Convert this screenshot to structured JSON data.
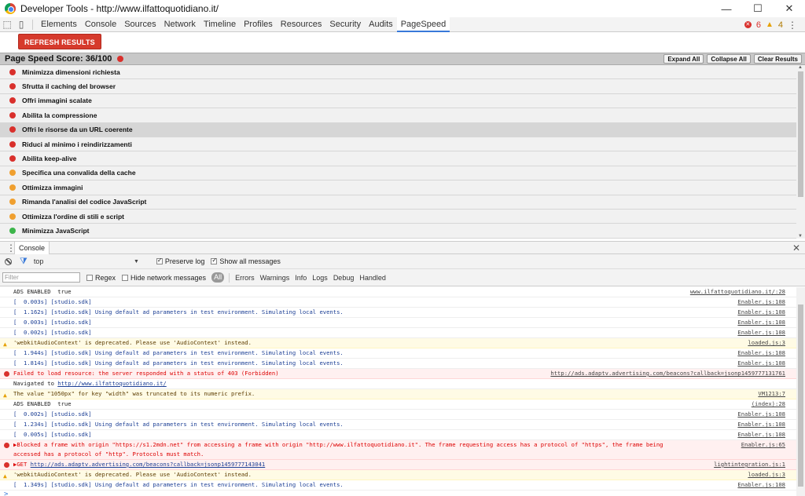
{
  "window": {
    "title": "Developer Tools - http://www.ilfattoquotidiano.it/",
    "minimize": "—",
    "maximize": "☐",
    "close": "✕"
  },
  "devtools": {
    "tabs": [
      "Elements",
      "Console",
      "Sources",
      "Network",
      "Timeline",
      "Profiles",
      "Resources",
      "Security",
      "Audits",
      "PageSpeed"
    ],
    "active_tab": "PageSpeed",
    "error_count": "6",
    "warning_count": "4"
  },
  "pagespeed": {
    "refresh_label": "REFRESH RESULTS",
    "score_label": "Page Speed Score: 36/100",
    "expand_all": "Expand All",
    "collapse_all": "Collapse All",
    "clear_results": "Clear Results",
    "rules": [
      {
        "label": "Minimizza dimensioni richiesta",
        "status": "red"
      },
      {
        "label": "Sfrutta il caching del browser",
        "status": "red"
      },
      {
        "label": "Offri immagini scalate",
        "status": "red"
      },
      {
        "label": "Abilita la compressione",
        "status": "red"
      },
      {
        "label": "Offri le risorse da un URL coerente",
        "status": "red"
      },
      {
        "label": "Riduci al minimo i reindirizzamenti",
        "status": "red"
      },
      {
        "label": "Abilita keep-alive",
        "status": "red"
      },
      {
        "label": "Specifica una convalida della cache",
        "status": "orange"
      },
      {
        "label": "Ottimizza immagini",
        "status": "orange"
      },
      {
        "label": "Rimanda l'analisi del codice JavaScript",
        "status": "orange"
      },
      {
        "label": "Ottimizza l'ordine di stili e script",
        "status": "orange"
      },
      {
        "label": "Minimizza JavaScript",
        "status": "green"
      }
    ]
  },
  "drawer": {
    "tab": "Console",
    "close": "✕"
  },
  "console_toolbar": {
    "context": "top",
    "preserve_log": "Preserve log",
    "show_all": "Show all messages"
  },
  "console_filter": {
    "placeholder": "Filter",
    "regex": "Regex",
    "hide_network": "Hide network messages",
    "levels": [
      "All",
      "Errors",
      "Warnings",
      "Info",
      "Logs",
      "Debug",
      "Handled"
    ]
  },
  "console": {
    "rows": [
      {
        "type": "log",
        "text": "ADS ENABLED  true",
        "src": "www.ilfattoquotidiano.it/:28"
      },
      {
        "type": "blue",
        "text": "[  0.003s] [studio.sdk]",
        "src": "Enabler.js:108"
      },
      {
        "type": "blue",
        "text": "[  1.162s] [studio.sdk] Using default ad parameters in test environment. Simulating local events.",
        "src": "Enabler.js:108"
      },
      {
        "type": "blue",
        "text": "[  0.003s] [studio.sdk]",
        "src": "Enabler.js:108"
      },
      {
        "type": "blue",
        "text": "[  0.002s] [studio.sdk]",
        "src": "Enabler.js:108"
      },
      {
        "type": "warn",
        "text": "'webkitAudioContext' is deprecated. Please use 'AudioContext' instead.",
        "src": "loaded.js:3"
      },
      {
        "type": "blue",
        "text": "[  1.944s] [studio.sdk] Using default ad parameters in test environment. Simulating local events.",
        "src": "Enabler.js:108"
      },
      {
        "type": "blue",
        "text": "[  1.814s] [studio.sdk] Using default ad parameters in test environment. Simulating local events.",
        "src": "Enabler.js:108"
      },
      {
        "type": "err",
        "text": "Failed to load resource: the server responded with a status of 403 (Forbidden)",
        "src": "http://ads.adaptv.advertising.com/beacons?callback=jsonp1459777131761"
      },
      {
        "type": "nav",
        "text": "Navigated to ",
        "link": "http://www.ilfattoquotidiano.it/",
        "src": ""
      },
      {
        "type": "warn",
        "text": "The value \"1050px\" for key \"width\" was truncated to its numeric prefix.",
        "src": "VM1213:7"
      },
      {
        "type": "log",
        "text": "ADS ENABLED  true",
        "src": "(index):28"
      },
      {
        "type": "blue",
        "text": "[  0.002s] [studio.sdk]",
        "src": "Enabler.js:108"
      },
      {
        "type": "blue",
        "text": "[  1.234s] [studio.sdk] Using default ad parameters in test environment. Simulating local events.",
        "src": "Enabler.js:108"
      },
      {
        "type": "blue",
        "text": "[  0.005s] [studio.sdk]",
        "src": "Enabler.js:108"
      },
      {
        "type": "errtall",
        "text": "▶Blocked a frame with origin \"https://s1.2mdn.net\" from accessing a frame with origin \"http://www.ilfattoquotidiano.it\".  The frame requesting access has a protocol of \"https\", the frame being accessed has a protocol of \"http\". Protocols must match.",
        "src": "Enabler.js:65"
      },
      {
        "type": "err",
        "text": "▶GET ",
        "link": "http://ads.adaptv.advertising.com/beacons?callback=jsonp1459777143041",
        "src": "lightintegration.js:1"
      },
      {
        "type": "warn",
        "text": "'webkitAudioContext' is deprecated. Please use 'AudioContext' instead.",
        "src": "loaded.js:3"
      },
      {
        "type": "blue",
        "text": "[  1.349s] [studio.sdk] Using default ad parameters in test environment. Simulating local events.",
        "src": "Enabler.js:108"
      }
    ],
    "prompt": ">"
  }
}
